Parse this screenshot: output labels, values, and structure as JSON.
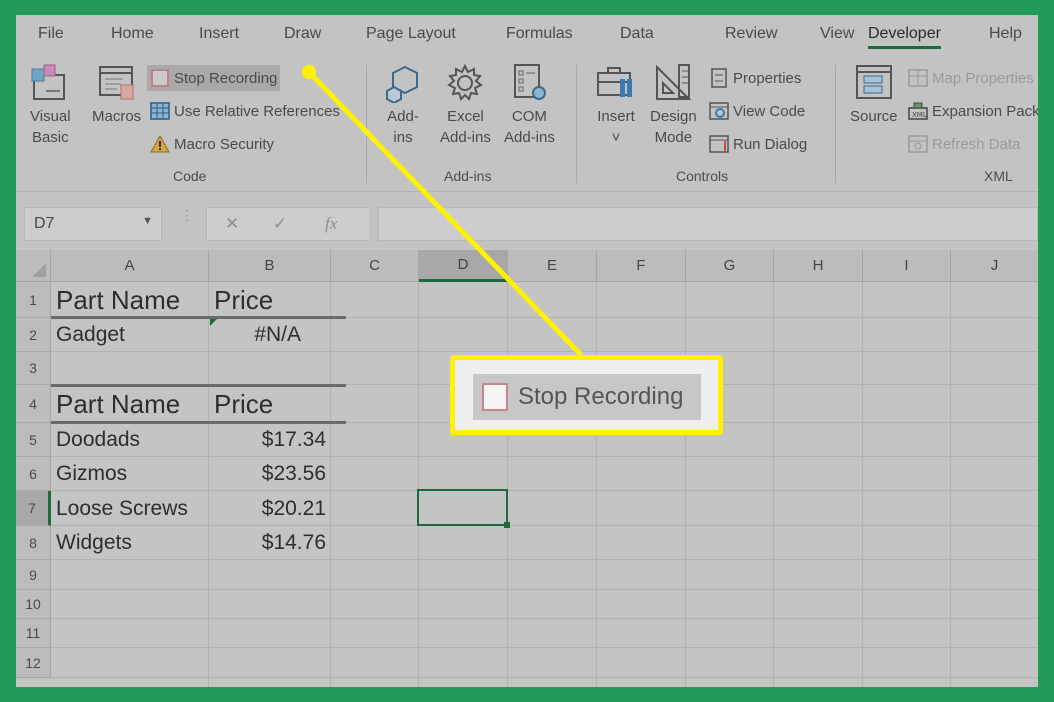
{
  "menu": {
    "tabs": [
      {
        "label": "File"
      },
      {
        "label": "Home"
      },
      {
        "label": "Insert"
      },
      {
        "label": "Draw"
      },
      {
        "label": "Page Layout"
      },
      {
        "label": "Formulas"
      },
      {
        "label": "Data"
      },
      {
        "label": "Review"
      },
      {
        "label": "View"
      },
      {
        "label": "Developer",
        "active": true
      },
      {
        "label": "Help"
      }
    ]
  },
  "ribbon": {
    "code": {
      "group_label": "Code",
      "visual_basic": "Visual\nBasic",
      "macros": "Macros",
      "stop_recording": "Stop Recording",
      "use_relative": "Use Relative References",
      "macro_security": "Macro Security"
    },
    "addins": {
      "group_label": "Add-ins",
      "addins": "Add-\nins",
      "excel_addins": "Excel\nAdd-ins",
      "com_addins": "COM\nAdd-ins"
    },
    "controls": {
      "group_label": "Controls",
      "insert": "Insert\n˅",
      "design_mode": "Design\nMode",
      "properties": "Properties",
      "view_code": "View Code",
      "run_dialog": "Run Dialog"
    },
    "xml": {
      "group_label": "XML",
      "source": "Source",
      "map_properties": "Map Properties",
      "expansion_packs": "Expansion Packs",
      "refresh_data": "Refresh Data"
    }
  },
  "formula_bar": {
    "name_box": "D7",
    "cancel": "✕",
    "enter": "✓",
    "fx": "fx",
    "value": ""
  },
  "sheet": {
    "columns": [
      "A",
      "B",
      "C",
      "D",
      "E",
      "F",
      "G",
      "H",
      "I",
      "J"
    ],
    "selected_column": "D",
    "rows": [
      "1",
      "2",
      "3",
      "4",
      "5",
      "6",
      "7",
      "8",
      "9",
      "10",
      "11",
      "12"
    ],
    "selected_row": "7",
    "active_cell": "D7",
    "cells": {
      "A1": "Part Name",
      "B1": "Price",
      "A2": "Gadget",
      "B2": "#N/A",
      "A4": "Part Name",
      "B4": "Price",
      "A5": "Doodads",
      "B5": "$17.34",
      "A6": "Gizmos",
      "B6": "$23.56",
      "A7": "Loose Screws",
      "B7": "$20.21",
      "A8": "Widgets",
      "B8": "$14.76"
    }
  },
  "callout": {
    "label": "Stop Recording",
    "color": "#fff200"
  },
  "colors": {
    "background": "#229a58",
    "accent": "#1d6b3a",
    "highlight": "#fff200"
  }
}
